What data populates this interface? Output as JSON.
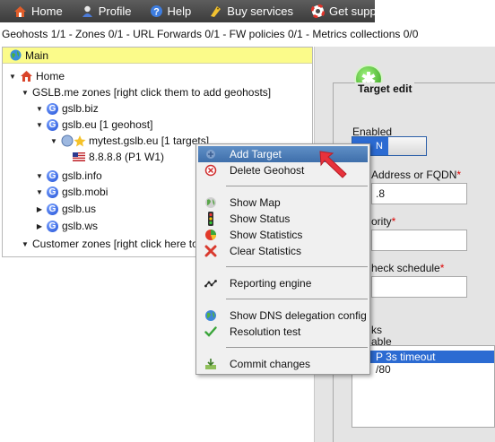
{
  "topbar": {
    "items": [
      {
        "label": "Home",
        "icon": "house-icon"
      },
      {
        "label": "Profile",
        "icon": "user-icon"
      },
      {
        "label": "Help",
        "icon": "help-icon"
      },
      {
        "label": "Buy services",
        "icon": "tag-icon"
      },
      {
        "label": "Get support",
        "icon": "lifebuoy-icon"
      }
    ]
  },
  "stats": "Geohosts 1/1 - Zones 0/1 - URL Forwards 0/1 - FW policies 0/1 - Metrics collections 0/0",
  "left_panel": {
    "header": "Main",
    "tree": {
      "home": "Home",
      "gslb_zones": "GSLB.me zones [right click them to add geohosts]",
      "zones": [
        "gslb.biz",
        "gslb.eu [1 geohost]",
        "gslb.info",
        "gslb.mobi",
        "gslb.us",
        "gslb.ws"
      ],
      "geohost": "mytest.gslb.eu [1 targets]",
      "target": "8.8.8.8 (P1 W1)",
      "customer_zones": "Customer zones [right click here to"
    }
  },
  "right_panel": {
    "title": "Target edit",
    "enabled_label": "Enabled",
    "toggle_text": "N",
    "address_label": "Address or FQDN",
    "address_value": ".8",
    "priority_label": "ority",
    "schedule_label": "heck schedule",
    "checks_label": "ks",
    "checks_sub": "able",
    "checks": [
      "P 3s timeout",
      "/80"
    ],
    "required_mark": "*"
  },
  "context_menu": {
    "items": [
      {
        "label": "Add Target",
        "icon": "add-target-icon",
        "highlighted": true
      },
      {
        "label": "Delete Geohost",
        "icon": "delete-icon"
      },
      {
        "label": "Show Map",
        "icon": "map-icon"
      },
      {
        "label": "Show Status",
        "icon": "traffic-light-icon"
      },
      {
        "label": "Show Statistics",
        "icon": "pie-chart-icon"
      },
      {
        "label": "Clear Statistics",
        "icon": "clear-x-icon"
      },
      {
        "label": "Reporting engine",
        "icon": "reporting-icon"
      },
      {
        "label": "Show DNS delegation config",
        "icon": "globe-icon"
      },
      {
        "label": "Resolution test",
        "icon": "check-icon"
      },
      {
        "label": "Commit changes",
        "icon": "commit-icon"
      }
    ]
  },
  "colors": {
    "topbar": "#4a4a4a",
    "header_yellow": "#fbfb8a",
    "menu_highlight": "#4f7fbb",
    "accent_blue": "#2c6bd2",
    "arrow_red": "#e8323c"
  }
}
